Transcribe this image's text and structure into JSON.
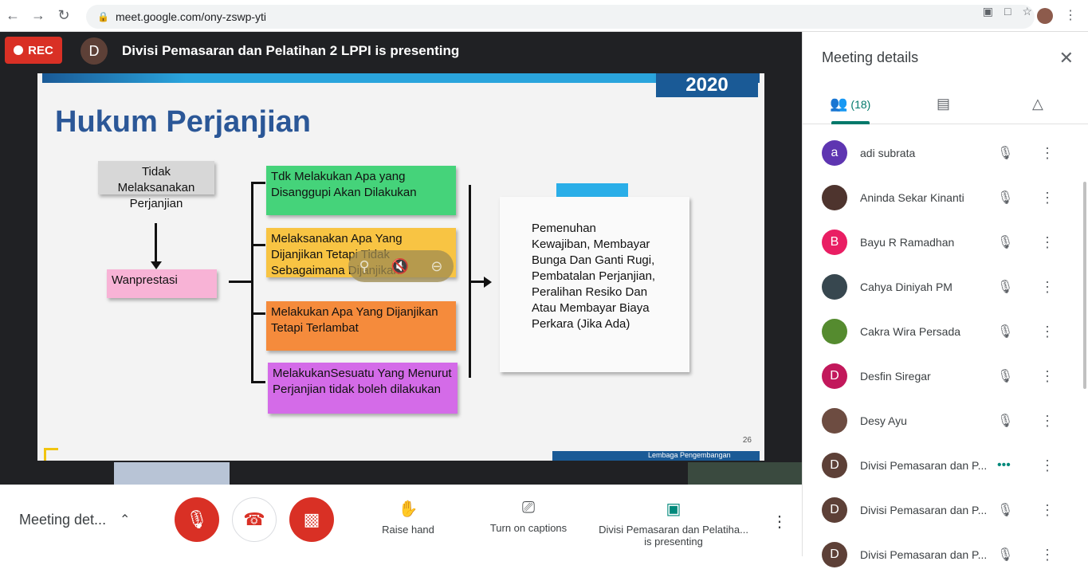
{
  "browser": {
    "url": "meet.google.com/ony-zswp-yti"
  },
  "stage": {
    "rec_label": "REC",
    "presenter_initial": "D",
    "presenter_text": "Divisi Pemasaran dan Pelatihan 2 LPPI is presenting"
  },
  "slide": {
    "year": "2020",
    "title": "Hukum Perjanjian",
    "box_gray": "Tidak Melaksanakan Perjanjian",
    "box_pink": "Wanprestasi",
    "box_green": "Tdk Melakukan Apa yang Disanggupi Akan Dilakukan",
    "box_yellow": "Melaksanakan Apa Yang Dijanjikan Tetapi Tidak Sebagaimana Dijanjikan",
    "box_orange": "Melakukan Apa Yang Dijanjikan Tetapi Terlambat",
    "box_purple": "MelakukanSesuatu Yang Menurut Perjanjian tidak boleh dilakukan",
    "box_white": "Pemenuhan Kewajiban, Membayar Bunga Dan Ganti Rugi, Pembatalan Perjanjian, Peralihan Resiko Dan Atau Membayar Biaya Perkara (Jika Ada)",
    "page_number": "26",
    "footer_text": "Lembaga Pengembangan"
  },
  "bottom_bar": {
    "meeting_label": "Meeting det...",
    "raise_hand": "Raise hand",
    "captions": "Turn on captions",
    "presenting": "Divisi Pemasaran dan Pelatiha... is presenting"
  },
  "panel": {
    "title": "Meeting details",
    "people_count": "(18)",
    "participants": [
      {
        "initial": "a",
        "name": "adi subrata",
        "color": "#5e35b1"
      },
      {
        "initial": "",
        "name": "Aninda Sekar Kinanti",
        "color": "#4e342e"
      },
      {
        "initial": "B",
        "name": "Bayu R Ramadhan",
        "color": "#e91e63"
      },
      {
        "initial": "",
        "name": "Cahya Diniyah PM",
        "color": "#37474f"
      },
      {
        "initial": "",
        "name": "Cakra Wira Persada",
        "color": "#558b2f"
      },
      {
        "initial": "D",
        "name": "Desfin Siregar",
        "color": "#c2185b"
      },
      {
        "initial": "",
        "name": "Desy Ayu",
        "color": "#6d4c41"
      },
      {
        "initial": "D",
        "name": "Divisi Pemasaran dan P...",
        "color": "#5d4037"
      },
      {
        "initial": "D",
        "name": "Divisi Pemasaran dan P...",
        "color": "#5d4037"
      },
      {
        "initial": "D",
        "name": "Divisi Pemasaran dan P...",
        "color": "#5d4037"
      }
    ]
  }
}
